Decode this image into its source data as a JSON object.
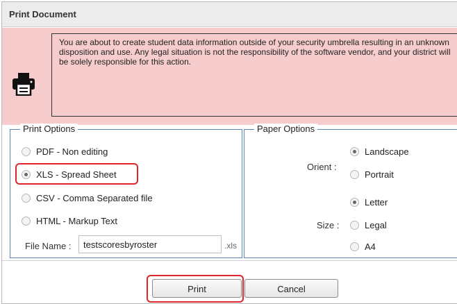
{
  "dialog": {
    "title": "Print Document",
    "warning": "You are about to create student data information outside of your security umbrella resulting in an unknown disposition and use. Any legal situation is not the responsibility of the software vendor, and your district will be solely responsible for this action."
  },
  "print_options": {
    "legend": "Print Options",
    "items": [
      {
        "label": "PDF - Non editing",
        "checked": false
      },
      {
        "label": "XLS - Spread Sheet",
        "checked": true
      },
      {
        "label": "CSV - Comma Separated file",
        "checked": false
      },
      {
        "label": "HTML - Markup Text",
        "checked": false
      }
    ],
    "file_name_label": "File Name :",
    "file_name_value": "testscoresbyroster",
    "extension": ".xls"
  },
  "paper_options": {
    "legend": "Paper Options",
    "orient_label": "Orient :",
    "orient_items": [
      {
        "label": "Landscape",
        "checked": true
      },
      {
        "label": "Portrait",
        "checked": false
      }
    ],
    "size_label": "Size :",
    "size_items": [
      {
        "label": "Letter",
        "checked": true
      },
      {
        "label": "Legal",
        "checked": false
      },
      {
        "label": "A4",
        "checked": false
      }
    ]
  },
  "buttons": {
    "print": "Print",
    "cancel": "Cancel"
  },
  "colors": {
    "warning_bg": "#f6cccc",
    "highlight": "#e0242b",
    "fieldset_border": "#5c86b8"
  },
  "icons": [
    "printer-icon"
  ]
}
